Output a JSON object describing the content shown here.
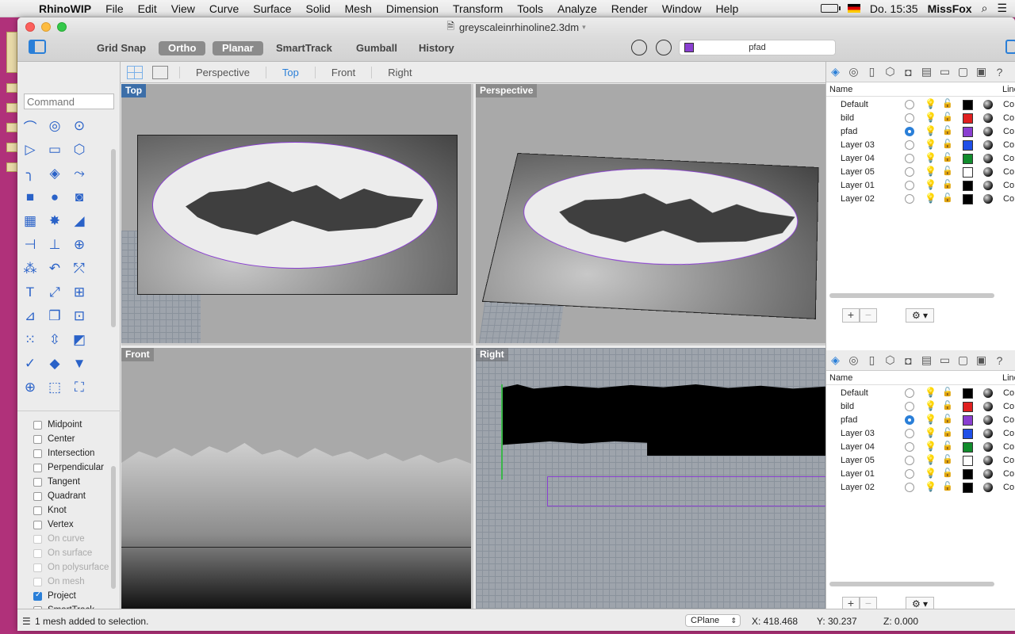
{
  "menubar": {
    "app": "RhinoWIP",
    "items": [
      "File",
      "Edit",
      "View",
      "Curve",
      "Surface",
      "Solid",
      "Mesh",
      "Dimension",
      "Transform",
      "Tools",
      "Analyze",
      "Render",
      "Window",
      "Help"
    ],
    "clock": "Do. 15:35",
    "user": "MissFox"
  },
  "window": {
    "title": "greyscaleinrhinoline2.3dm",
    "toolbar": {
      "grid_snap": "Grid Snap",
      "ortho": "Ortho",
      "planar": "Planar",
      "smarttrack": "SmartTrack",
      "gumball": "Gumball",
      "history": "History",
      "current_layer": "pfad",
      "current_layer_color": "#8a3fd1"
    }
  },
  "command": {
    "placeholder": "Command"
  },
  "osnaps": [
    {
      "label": "Midpoint",
      "checked": false,
      "enabled": true
    },
    {
      "label": "Center",
      "checked": false,
      "enabled": true
    },
    {
      "label": "Intersection",
      "checked": false,
      "enabled": true
    },
    {
      "label": "Perpendicular",
      "checked": false,
      "enabled": true
    },
    {
      "label": "Tangent",
      "checked": false,
      "enabled": true
    },
    {
      "label": "Quadrant",
      "checked": false,
      "enabled": true
    },
    {
      "label": "Knot",
      "checked": false,
      "enabled": true
    },
    {
      "label": "Vertex",
      "checked": false,
      "enabled": true
    },
    {
      "label": "On curve",
      "checked": false,
      "enabled": false
    },
    {
      "label": "On surface",
      "checked": false,
      "enabled": false
    },
    {
      "label": "On polysurface",
      "checked": false,
      "enabled": false
    },
    {
      "label": "On mesh",
      "checked": false,
      "enabled": false
    },
    {
      "label": "Project",
      "checked": true,
      "enabled": true
    },
    {
      "label": "SmartTrack",
      "checked": false,
      "enabled": true
    }
  ],
  "viewport_tabs": [
    "Perspective",
    "Top",
    "Front",
    "Right"
  ],
  "active_viewport_tab": "Top",
  "viewports": {
    "top": "Top",
    "perspective": "Perspective",
    "front": "Front",
    "right": "Right"
  },
  "layers_panel": {
    "header_name": "Name",
    "header_line": "Line",
    "layers": [
      {
        "name": "Default",
        "current": false,
        "on": true,
        "color": "#000000",
        "linetype": "Co"
      },
      {
        "name": "bild",
        "current": false,
        "on": false,
        "color": "#e02020",
        "linetype": "Co"
      },
      {
        "name": "pfad",
        "current": true,
        "on": false,
        "color": "#8a3fd1",
        "linetype": "Co"
      },
      {
        "name": "Layer 03",
        "current": false,
        "on": false,
        "color": "#1f4fe8",
        "linetype": "Co"
      },
      {
        "name": "Layer 04",
        "current": false,
        "on": false,
        "color": "#118c2c",
        "linetype": "Co"
      },
      {
        "name": "Layer 05",
        "current": false,
        "on": false,
        "color": "#ffffff",
        "linetype": "Co"
      },
      {
        "name": "Layer 01",
        "current": false,
        "on": true,
        "color": "#000000",
        "linetype": "Co"
      },
      {
        "name": "Layer 02",
        "current": false,
        "on": true,
        "color": "#000000",
        "linetype": "Co"
      }
    ]
  },
  "status": {
    "message": "1 mesh added to selection.",
    "cplane": "CPlane",
    "x": "X: 418.468",
    "y": "Y: 30.237",
    "z": "Z: 0.000"
  },
  "colors": {
    "accent": "#2a7fd8",
    "desktop": "#b0317a",
    "path_color": "#8a3fd1"
  }
}
